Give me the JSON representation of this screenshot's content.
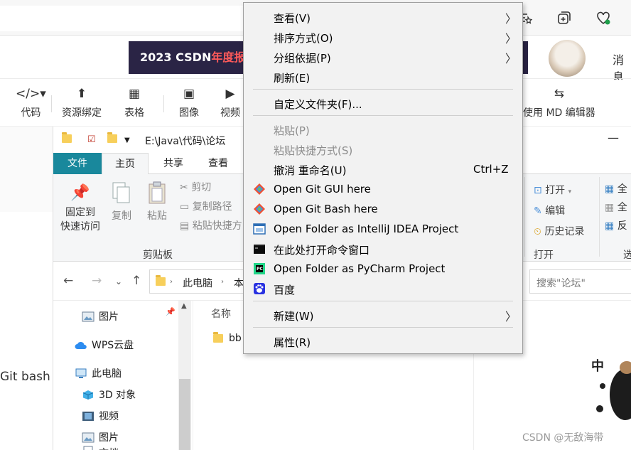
{
  "csdn": {
    "banner_year": "2023 CSDN",
    "banner_red": "年度报告",
    "messages_label": "消息",
    "toolbar": [
      {
        "icon": "code-icon",
        "label": "代码"
      },
      {
        "icon": "upload-resource-icon",
        "label": "资源绑定"
      },
      {
        "icon": "table-icon",
        "label": "表格"
      },
      {
        "icon": "image-icon",
        "label": "图像"
      },
      {
        "icon": "video-icon",
        "label": "视频"
      },
      {
        "icon": "switch-editor-icon",
        "label": "使用 MD 编辑器"
      }
    ],
    "git_bash_text": "Git bash",
    "watermark": "CSDN @无敌海带"
  },
  "explorer": {
    "title_path": "E:\\Java\\代码\\论坛",
    "tabs": [
      "文件",
      "主页",
      "共享",
      "查看"
    ],
    "ribbon": {
      "pin_label_1": "固定到",
      "pin_label_2": "快速访问",
      "copy": "复制",
      "paste": "粘贴",
      "cut": "剪切",
      "copy_path": "复制路径",
      "paste_shortcut": "粘贴快捷方",
      "clipboard_group": "剪贴板",
      "open": "打开",
      "edit": "编辑",
      "history": "历史记录",
      "open_group": "打开",
      "select_all": "全",
      "select_none": "全",
      "invert": "反",
      "select_group": "选"
    },
    "address": [
      "此电脑",
      "本"
    ],
    "search_placeholder": "搜索\"论坛\"",
    "nav_items": [
      {
        "icon": "pictures-icon",
        "label": "图片"
      },
      {
        "icon": "wps-cloud-icon",
        "label": "WPS云盘"
      },
      {
        "icon": "this-pc-icon",
        "label": "此电脑"
      },
      {
        "icon": "3d-objects-icon",
        "label": "3D 对象"
      },
      {
        "icon": "videos-icon",
        "label": "视频"
      },
      {
        "icon": "pictures-icon",
        "label": "图片"
      },
      {
        "icon": "documents-icon",
        "label": "文档"
      }
    ],
    "column_name": "名称",
    "files": [
      "bb"
    ]
  },
  "context_menu": {
    "items": [
      {
        "label": "查看(V)",
        "submenu": true
      },
      {
        "label": "排序方式(O)",
        "submenu": true
      },
      {
        "label": "分组依据(P)",
        "submenu": true
      },
      {
        "label": "刷新(E)"
      },
      {
        "label": "自定义文件夹(F)..."
      },
      {
        "label": "粘贴(P)",
        "disabled": true
      },
      {
        "label": "粘贴快捷方式(S)",
        "disabled": true
      },
      {
        "label": "撤消 重命名(U)",
        "shortcut": "Ctrl+Z"
      },
      {
        "label": "Open Git GUI here",
        "icon": "git-gui-icon"
      },
      {
        "label": "Open Git Bash here",
        "icon": "git-bash-icon"
      },
      {
        "label": "Open Folder as IntelliJ IDEA Project",
        "icon": "intellij-icon"
      },
      {
        "label": "在此处打开命令窗口",
        "icon": "cmd-icon"
      },
      {
        "label": "Open Folder as PyCharm Project",
        "icon": "pycharm-icon"
      },
      {
        "label": "百度",
        "icon": "baidu-icon"
      },
      {
        "label": "新建(W)",
        "submenu": true
      },
      {
        "label": "属性(R)"
      }
    ]
  }
}
